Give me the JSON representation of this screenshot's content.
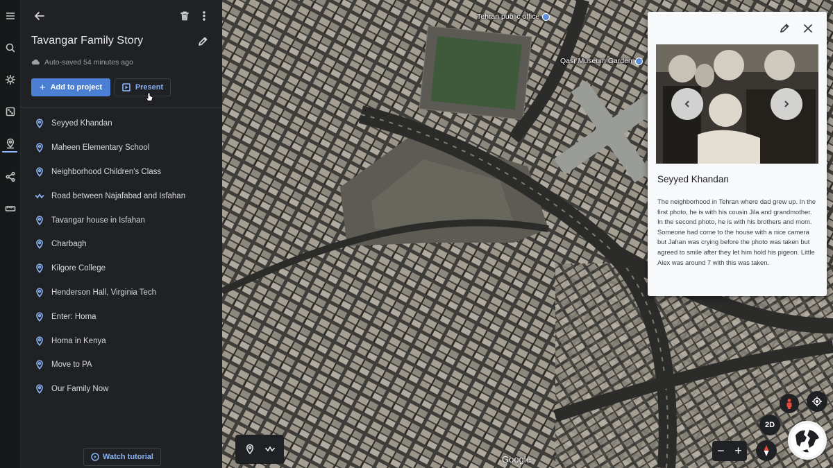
{
  "project": {
    "title": "Tavangar Family Story",
    "autosave": "Auto-saved 54 minutes ago",
    "add_label": "Add to project",
    "present_label": "Present",
    "tutorial_label": "Watch tutorial"
  },
  "items": [
    {
      "label": "Seyyed Khandan",
      "icon": "place-pin-icon"
    },
    {
      "label": "Maheen Elementary School",
      "icon": "place-pin-icon"
    },
    {
      "label": "Neighborhood Children's Class",
      "icon": "place-pin-icon"
    },
    {
      "label": "Road between Najafabad and Isfahan",
      "icon": "path-line-icon"
    },
    {
      "label": "Tavangar house in Isfahan",
      "icon": "place-pin-icon"
    },
    {
      "label": "Charbagh",
      "icon": "place-pin-icon"
    },
    {
      "label": "Kilgore College",
      "icon": "place-pin-icon"
    },
    {
      "label": "Henderson Hall, Virginia Tech",
      "icon": "place-pin-icon"
    },
    {
      "label": "Enter: Homa",
      "icon": "place-pin-icon"
    },
    {
      "label": "Homa in Kenya",
      "icon": "place-pin-icon"
    },
    {
      "label": "Move to PA",
      "icon": "place-pin-icon"
    },
    {
      "label": "Our Family Now",
      "icon": "place-pin-icon"
    }
  ],
  "map": {
    "poi_1": "Tehran public office",
    "poi_2": "Qasr Museum Garden",
    "attribution": "Google",
    "mode_label": "2D",
    "zoom_out": "−",
    "zoom_in": "+"
  },
  "card": {
    "title": "Seyyed Khandan",
    "description": "The neighborhood in Tehran where dad grew up. In the first photo, he is with his cousin Jila and grandmother. In the second photo, he is with his brothers and mom. Someone had come to the house with a nice camera but Jahan was crying before the photo was taken but agreed to smile after they let him hold his pigeon. Little Alex was around 7 with this was taken."
  },
  "colors": {
    "accent": "#8ab4f8",
    "primary_button": "#4a7fd4",
    "panel_bg": "#202124"
  }
}
